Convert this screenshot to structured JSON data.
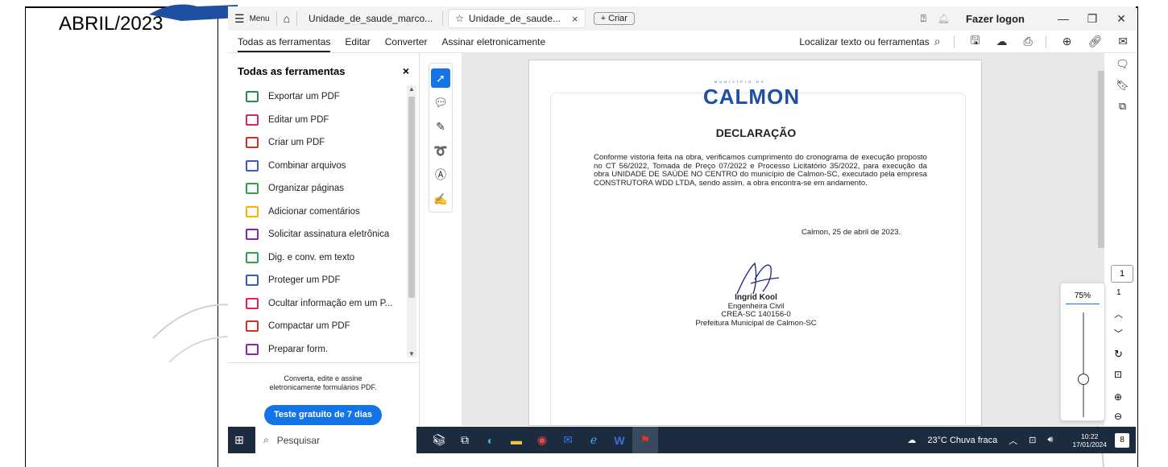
{
  "doc": {
    "caption": "ABRIL/2023"
  },
  "titlebar": {
    "menu_label": "Menu",
    "tabs": [
      {
        "label": "Unidade_de_saude_marco..."
      },
      {
        "label": "Unidade_de_saude..."
      }
    ],
    "create_label": "+ Criar",
    "logon_label": "Fazer logon",
    "close_tab": "×"
  },
  "menubar": {
    "items": [
      "Todas as ferramentas",
      "Editar",
      "Converter",
      "Assinar eletronicamente"
    ],
    "search_label": "Localizar texto ou ferramentas"
  },
  "panel": {
    "title": "Todas as ferramentas",
    "close": "×",
    "tools": [
      {
        "label": "Exportar um PDF",
        "color": "#2e8b57"
      },
      {
        "label": "Editar um PDF",
        "color": "#e0245e"
      },
      {
        "label": "Criar um PDF",
        "color": "#d93025"
      },
      {
        "label": "Combinar arquivos",
        "color": "#3a5bc7"
      },
      {
        "label": "Organizar páginas",
        "color": "#2ea44f"
      },
      {
        "label": "Adicionar comentários",
        "color": "#f4b400"
      },
      {
        "label": "Solicitar assinatura eletrônica",
        "color": "#8e24aa"
      },
      {
        "label": "Dig. e conv. em texto",
        "color": "#2ea44f"
      },
      {
        "label": "Proteger um PDF",
        "color": "#3a5bc7"
      },
      {
        "label": "Ocultar informação em um P...",
        "color": "#e0245e"
      },
      {
        "label": "Compactar um PDF",
        "color": "#d93025"
      },
      {
        "label": "Preparar form.",
        "color": "#8e24aa"
      }
    ],
    "footer_text": "Converta, edite e assine eletronicamente formulários PDF.",
    "trial_button": "Teste gratuito de 7 dias"
  },
  "pdf": {
    "logo_small": "MUNICÍPIO DE",
    "logo": "CALMON",
    "title": "DECLARAÇÃO",
    "body": "Conforme vistoria feita na obra, verificamos cumprimento do cronograma de execução proposto no CT 56/2022, Tomada de Preço 07/2022 e Processo Licitatório 35/2022, para execução da obra UNIDADE DE SAÚDE NO CENTRO do município de Calmon-SC, executado pela empresa CONSTRUTORA WDD LTDA, sendo assim, a obra encontra-se em andamento.",
    "date": "Calmon, 25 de abril de 2023.",
    "signer_name": "Ingrid Kool",
    "signer_role": "Engenheira Civil",
    "signer_crea": "CREA-SC 140156-0",
    "signer_org": "Prefeitura Municipal de Calmon-SC"
  },
  "nav": {
    "page_current": "1",
    "page_total": "1",
    "zoom": "75%",
    "zoom_level": 0.75
  },
  "taskbar": {
    "search_placeholder": "Pesquisar",
    "weather": "23°C  Chuva fraca",
    "time": "10:22",
    "date": "17/01/2024",
    "notifications": "8"
  }
}
